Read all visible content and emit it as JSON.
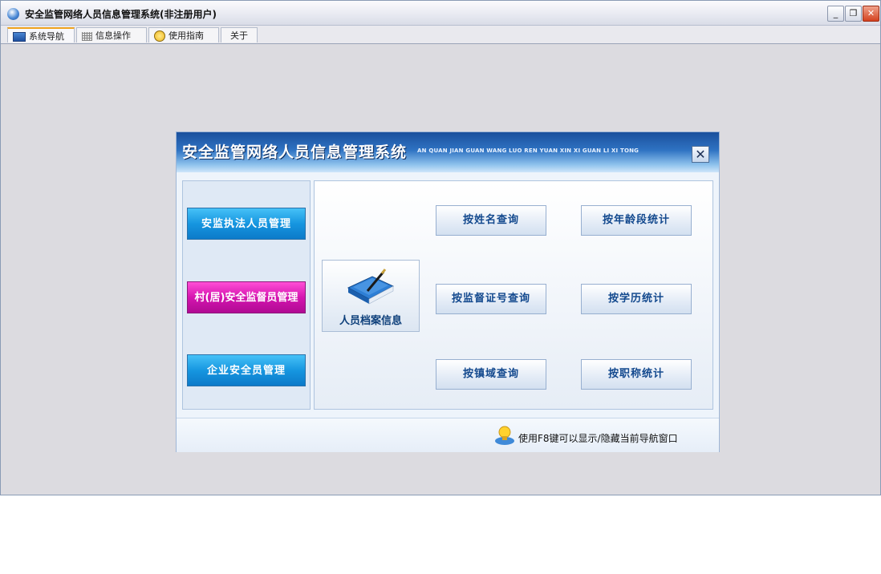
{
  "window": {
    "title": "安全监管网络人员信息管理系统(非注册用户)",
    "controls": {
      "minimize": "_",
      "restore": "❐",
      "close": "✕"
    }
  },
  "tabs": [
    {
      "label": "系统导航",
      "icon": "monitor-icon",
      "active": true
    },
    {
      "label": "信息操作",
      "icon": "grid-icon",
      "active": false
    },
    {
      "label": "使用指南",
      "icon": "smiley-icon",
      "active": false
    },
    {
      "label": "关于",
      "icon": "",
      "active": false
    }
  ],
  "panel": {
    "title": "安全监管网络人员信息管理系统",
    "subtitle_pinyin": "AN QUAN JIAN GUAN WANG LUO REN YUAN XIN XI GUAN LI XI TONG",
    "close_label": "✕",
    "left_buttons": [
      {
        "label": "安监执法人员管理",
        "color": "#1696e0"
      },
      {
        "label": "村(居)安全监督员管理",
        "color": "#d515b0"
      },
      {
        "label": "企业安全员管理",
        "color": "#1696e0"
      }
    ],
    "archive": {
      "label": "人员档案信息",
      "icon": "book-icon"
    },
    "query_buttons": [
      {
        "label": "按姓名查询"
      },
      {
        "label": "按年龄段统计"
      },
      {
        "label": "按监督证号查询"
      },
      {
        "label": "按学历统计"
      },
      {
        "label": "按镇域查询"
      },
      {
        "label": "按职称统计"
      }
    ],
    "footer": {
      "hint": "使用F8键可以显示/隐藏当前导航窗口",
      "icon": "lightbulb-icon"
    }
  },
  "colors": {
    "header_dark": "#1a4f9c",
    "accent_tab": "#f0a31e",
    "button_text": "#13498e"
  }
}
